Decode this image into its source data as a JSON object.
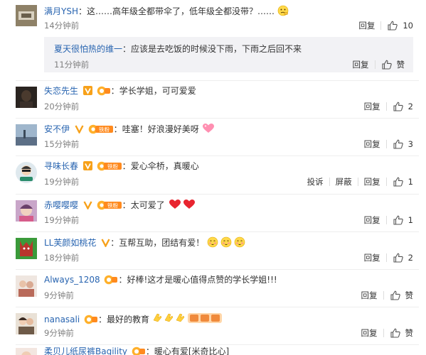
{
  "comments": [
    {
      "user": "满月YSH",
      "text": "这……高年级全都带伞了，低年级全都没带？……",
      "time": "14分钟前",
      "reply": "回复",
      "likes": "10"
    },
    {
      "user": "夏天很怕热的维一",
      "text": "应该是去吃饭的时候没下雨，下雨之后回不来",
      "time": "11分钟前",
      "reply": "回复",
      "likes": "赞"
    },
    {
      "user": "失恋先生",
      "text": "学长学姐，可可爱爱",
      "time": "20分钟前",
      "reply": "回复",
      "likes": "2"
    },
    {
      "user": "安不伊",
      "text": "哇塞！好浪漫好美呀",
      "time": "15分钟前",
      "reply": "回复",
      "likes": "3"
    },
    {
      "user": "寻味长春",
      "text": "爱心伞桥，真暖心",
      "time": "19分钟前",
      "complain": "投诉",
      "block": "屏蔽",
      "reply": "回复",
      "likes": "1"
    },
    {
      "user": "赤嘤嘤嘤",
      "text": "太可爱了",
      "time": "19分钟前",
      "reply": "回复",
      "likes": "1"
    },
    {
      "user": "LL芙颜如桃花",
      "text": "互帮互助，团结有爱！",
      "time": "18分钟前",
      "reply": "回复",
      "likes": "2"
    },
    {
      "user": "Always_1208",
      "text": "好棒!这才是暖心值得点赞的学长学姐!!!",
      "time": "9分钟前",
      "reply": "回复",
      "likes": "赞"
    },
    {
      "user": "nanasali",
      "text": "最好的教育",
      "time": "9分钟前",
      "reply": "回复",
      "likes": "赞"
    },
    {
      "user": "柔贝儿纸尿裤Bagility",
      "text": "暖心有爱[米奇比心]"
    }
  ],
  "badges": {
    "fan_label": "铁粉"
  },
  "colors": {
    "link": "#2864b0",
    "time": "#808080",
    "reply_bg": "#f2f2f5",
    "vip_orange": "#f7a11a",
    "fan_orange": "#ff8a1e",
    "divider": "#eeeeee"
  },
  "icons": {
    "like": "thumbs-up-icon",
    "vip": "vip-badge-icon",
    "fan": "fan-badge-icon",
    "verified": "verified-v-icon"
  }
}
